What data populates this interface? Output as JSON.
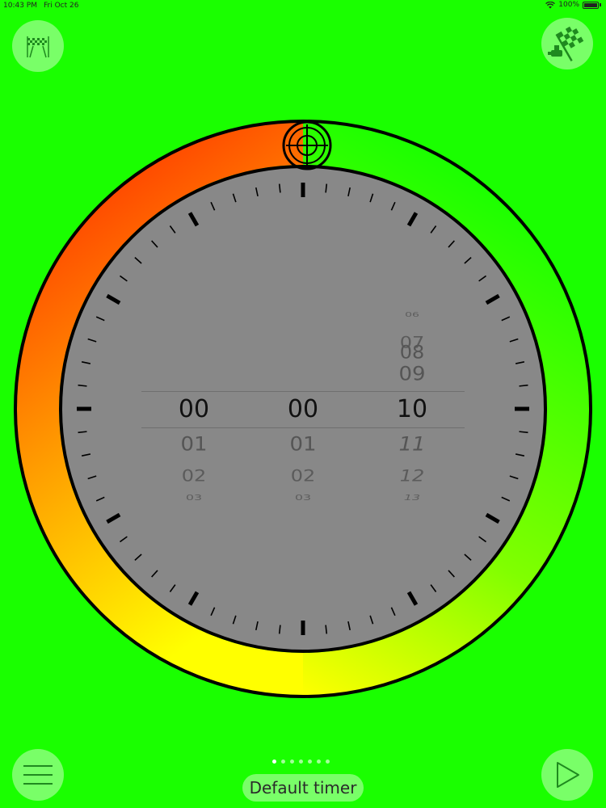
{
  "status_bar": {
    "time": "10:43 PM",
    "date": "Fri Oct 26",
    "battery": "100%"
  },
  "buttons": {
    "start_flag_icon": "start-flag-icon",
    "finish_flag_icon": "finish-flag-icon",
    "menu_icon": "hamburger-menu-icon",
    "play_icon": "play-icon"
  },
  "timer_picker": {
    "hours": {
      "above": [
        "",
        "",
        ""
      ],
      "selected": "00",
      "below": [
        "01",
        "02",
        "03"
      ]
    },
    "minutes": {
      "above": [
        "",
        "",
        ""
      ],
      "selected": "00",
      "below": [
        "01",
        "02",
        "03"
      ]
    },
    "seconds": {
      "above": [
        "06",
        "07",
        "08",
        "09"
      ],
      "selected": "10",
      "below": [
        "11",
        "12",
        "13"
      ]
    }
  },
  "page_indicator": {
    "count": 7,
    "active_index": 0
  },
  "timer_label": "Default timer",
  "colors": {
    "background": "#1aff00",
    "ring_start": "#ff1a00",
    "ring_mid": "#ffff00",
    "ring_end": "#1aff00",
    "dial_face": "#888888"
  }
}
